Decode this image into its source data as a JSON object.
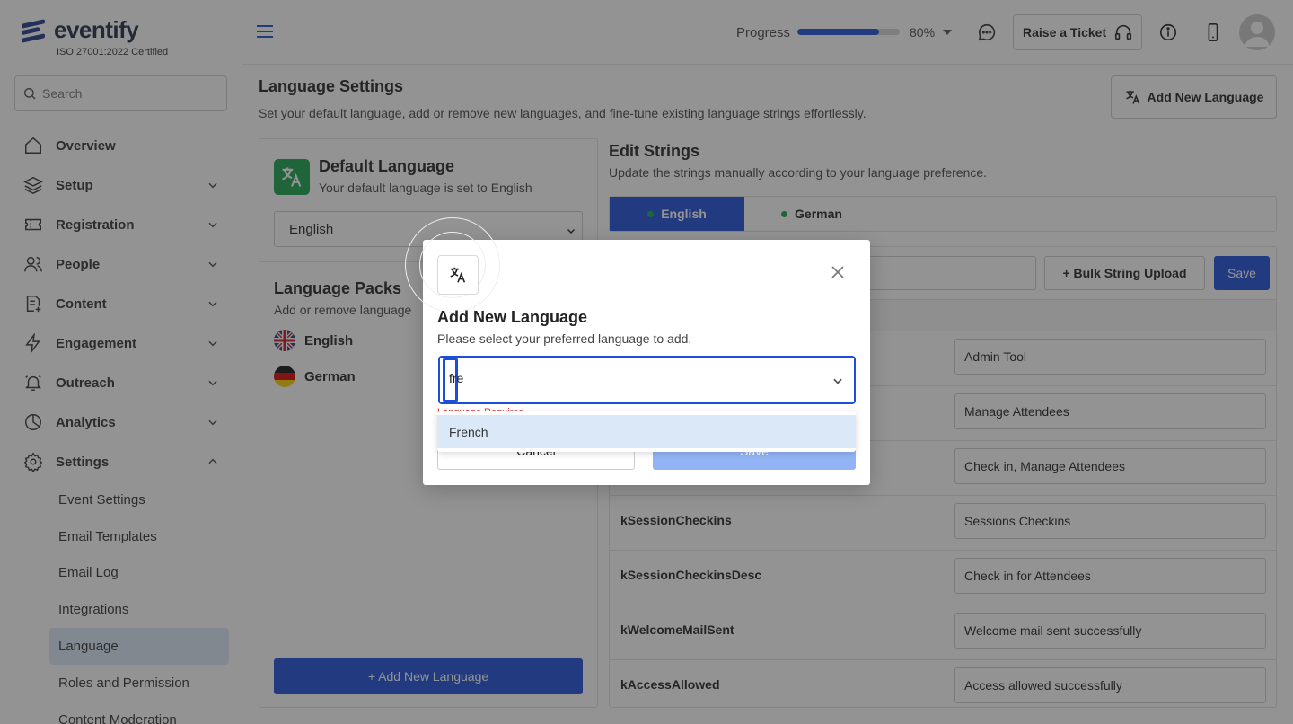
{
  "brand": {
    "name": "eventify",
    "certification": "ISO 27001:2022 Certified",
    "color": "#1e3a8a"
  },
  "search": {
    "placeholder": "Search"
  },
  "nav": {
    "items": [
      {
        "label": "Overview",
        "icon": "home-icon"
      },
      {
        "label": "Setup",
        "icon": "layers-icon"
      },
      {
        "label": "Registration",
        "icon": "ticket-icon"
      },
      {
        "label": "People",
        "icon": "users-icon"
      },
      {
        "label": "Content",
        "icon": "document-plus-icon"
      },
      {
        "label": "Engagement",
        "icon": "lightning-icon"
      },
      {
        "label": "Outreach",
        "icon": "bell-icon"
      },
      {
        "label": "Analytics",
        "icon": "pie-chart-icon"
      },
      {
        "label": "Settings",
        "icon": "gear-icon"
      }
    ],
    "settings_sub": [
      "Event Settings",
      "Email Templates",
      "Email Log",
      "Integrations",
      "Language",
      "Roles and Permission",
      "Content Moderation"
    ],
    "active_sub": "Language"
  },
  "header": {
    "progress_label": "Progress",
    "progress_value": "80%",
    "progress_fraction": 0.8,
    "ticket_label": "Raise a Ticket"
  },
  "page": {
    "title": "Language Settings",
    "subtitle": "Set your default language, add or remove new languages, and fine-tune existing language strings effortlessly.",
    "add_button": "Add New Language"
  },
  "default_language": {
    "title": "Default Language",
    "subtitle": "Your default language is set to English",
    "selected": "English"
  },
  "packs": {
    "title": "Language Packs",
    "subtitle": "Add or remove language",
    "items": [
      "English",
      "German"
    ],
    "add_button": "+ Add New Language"
  },
  "edit_strings": {
    "title": "Edit Strings",
    "subtitle": "Update the strings manually according to your language preference.",
    "tabs": [
      "English",
      "German"
    ],
    "bulk_button": "+ Bulk String Upload",
    "save_button": "Save",
    "rows": [
      {
        "key": "",
        "value": "Admin Tool"
      },
      {
        "key": "",
        "value": "Manage Attendees"
      },
      {
        "key": "",
        "value": "Check in, Manage Attendees"
      },
      {
        "key": "kSessionCheckins",
        "value": "Sessions Checkins"
      },
      {
        "key": "kSessionCheckinsDesc",
        "value": "Check in for Attendees"
      },
      {
        "key": "kWelcomeMailSent",
        "value": "Welcome mail sent successfully"
      },
      {
        "key": "kAccessAllowed",
        "value": "Access allowed successfully"
      }
    ]
  },
  "modal": {
    "title": "Add New Language",
    "subtitle": "Please select your preferred language to add.",
    "input_value": "fre",
    "error": "Language Required",
    "option": "French",
    "cancel": "Cancel",
    "save": "Save"
  }
}
